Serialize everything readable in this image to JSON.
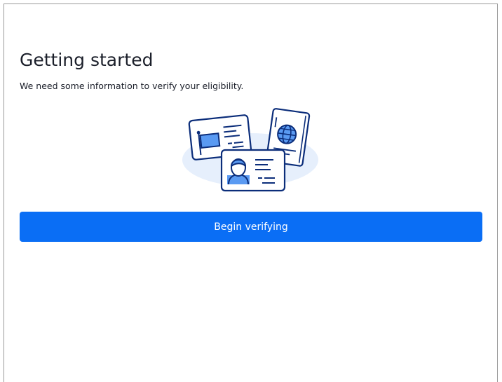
{
  "header": {
    "title": "Getting started",
    "subtitle": "We need some information to verify your eligibility."
  },
  "illustration": {
    "icon": "identity-documents-icon"
  },
  "actions": {
    "begin_label": "Begin verifying"
  },
  "colors": {
    "primary": "#0a6ef5",
    "illustration_stroke": "#0b2d7a",
    "illustration_fill": "#5a9af2",
    "illustration_bg": "#e6effc"
  }
}
